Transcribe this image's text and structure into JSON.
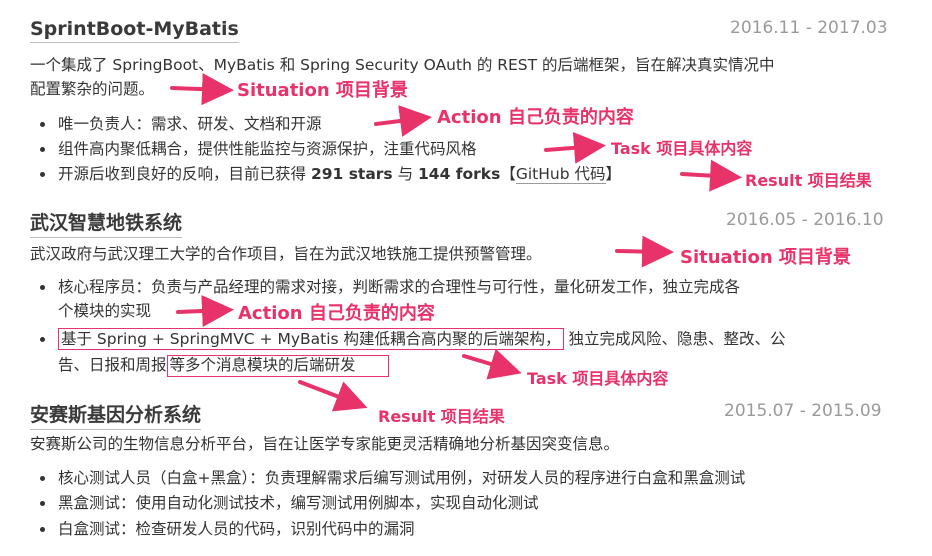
{
  "projects": [
    {
      "title": "SprintBoot-MyBatis",
      "date": "2016.11 - 2017.03",
      "desc_line1": "一个集成了 SpringBoot、MyBatis 和 Spring Security OAuth 的 REST 的后端框架，旨在解决真实情况中",
      "desc_line2": "配置繁杂的问题。",
      "bullets": [
        "唯一负责人：需求、研发、文档和开源",
        "组件高内聚低耦合，提供性能监控与资源保护，注重代码风格"
      ],
      "bullet3": {
        "before": "开源后收到良好的反响，目前已获得 ",
        "stars": "291 stars",
        "mid": " 与 ",
        "forks": "144 forks",
        "bracket_open": "【",
        "link": "GitHub 代码",
        "bracket_close": "】"
      }
    },
    {
      "title": "武汉智慧地铁系统",
      "date": "2016.05 - 2016.10",
      "desc": "武汉政府与武汉理工大学的合作项目，旨在为武汉地铁施工提供预警管理。",
      "bullet1_line1": "核心程序员：负责与产品经理的需求对接，判断需求的合理性与可行性，量化研发工作，独立完成各",
      "bullet1_line2": "个模块的实现",
      "bullet2_boxed": "基于 Spring + SpringMVC + MyBatis 构建低耦合高内聚的后端架构，",
      "bullet2_rest": "独立完成风险、隐患、整改、公",
      "bullet2_line2_a": "告、日报和周报",
      "bullet2_line2_boxed": "等多个消息模块的后端研发"
    },
    {
      "title": "安赛斯基因分析系统",
      "date": "2015.07 - 2015.09",
      "desc": "安赛斯公司的生物信息分析平台，旨在让医学专家能更灵活精确地分析基因突变信息。",
      "bullets": [
        "核心测试人员（白盒+黑盒）：负责理解需求后编写测试用例，对研发人员的程序进行白盒和黑盒测试",
        "黑盒测试：使用自动化测试技术，编写测试用例脚本，实现自动化测试",
        "白盒测试：检查研发人员的代码，识别代码中的漏洞"
      ]
    }
  ],
  "annotations": {
    "a1": "Situation 项目背景",
    "a2": "Action 自己负责的内容",
    "a3": "Task 项目具体内容",
    "a4": "Result 项目结果",
    "a5": "Situation 项目背景",
    "a6": "Action 自己负责的内容",
    "a7": "Task 项目具体内容",
    "a8": "Result 项目结果"
  },
  "colors": {
    "annotation": "#e8336a",
    "date": "#9a9a9a"
  }
}
